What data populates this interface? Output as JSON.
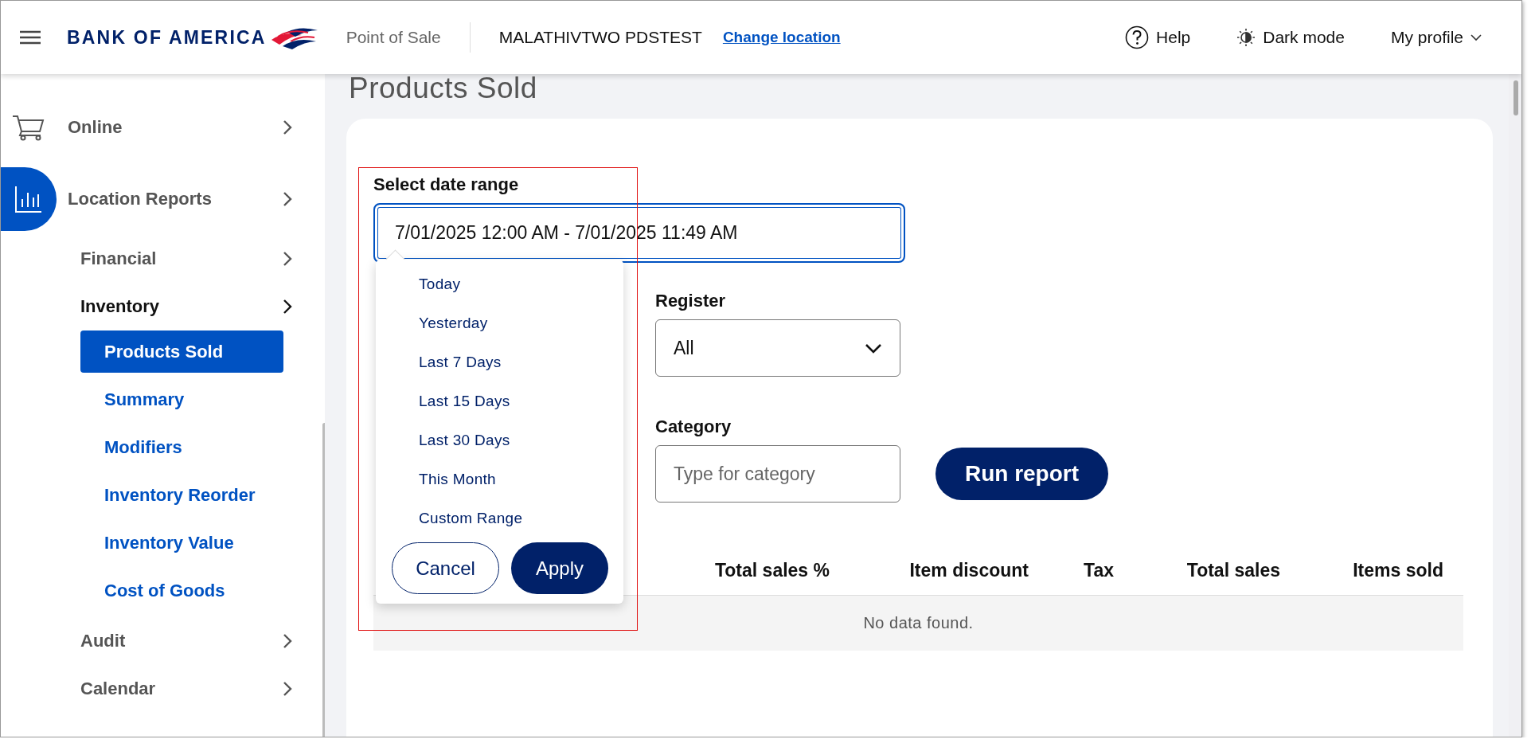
{
  "header": {
    "brand": "BANK OF AMERICA",
    "app_name": "Point of Sale",
    "location": "MALATHIVTWO PDSTEST",
    "change_location": "Change location",
    "actions": [
      {
        "kind": "help",
        "label": "Help"
      },
      {
        "kind": "theme",
        "label": "Dark mode"
      },
      {
        "kind": "profile",
        "label": "My profile"
      }
    ]
  },
  "sidebar": {
    "items": [
      {
        "label": "Online",
        "selected": false
      },
      {
        "label": "Location Reports",
        "selected": true,
        "children": [
          {
            "label": "Financial",
            "expanded": false
          },
          {
            "label": "Inventory",
            "expanded": true,
            "children": [
              {
                "label": "Products Sold",
                "selected": true
              },
              {
                "label": "Summary",
                "selected": false
              },
              {
                "label": "Modifiers",
                "selected": false
              },
              {
                "label": "Inventory Reorder",
                "selected": false
              },
              {
                "label": "Inventory Value",
                "selected": false
              },
              {
                "label": "Cost of Goods",
                "selected": false
              }
            ]
          },
          {
            "label": "Audit",
            "expanded": false
          },
          {
            "label": "Calendar",
            "expanded": false
          }
        ]
      }
    ]
  },
  "page": {
    "title": "Products Sold"
  },
  "date_range": {
    "label": "Select date range",
    "value": "7/01/2025 12:00 AM - 7/01/2025 11:49 AM",
    "focused": true,
    "open": true,
    "presets": [
      {
        "label": "Today",
        "selected": false
      },
      {
        "label": "Yesterday",
        "selected": false
      },
      {
        "label": "Last 7 Days",
        "selected": false
      },
      {
        "label": "Last 15 Days",
        "selected": false
      },
      {
        "label": "Last 30 Days",
        "selected": false
      },
      {
        "label": "This Month",
        "selected": false
      },
      {
        "label": "Custom Range",
        "selected": false
      }
    ],
    "cancel": "Cancel",
    "apply": "Apply"
  },
  "register": {
    "label": "Register",
    "value": "All"
  },
  "category": {
    "label": "Category",
    "placeholder": "Type for category"
  },
  "run_button": "Run report",
  "table": {
    "columns": [
      "Total sales %",
      "Item discount",
      "Tax",
      "Total sales",
      "Items sold"
    ],
    "empty_message": "No data found."
  }
}
